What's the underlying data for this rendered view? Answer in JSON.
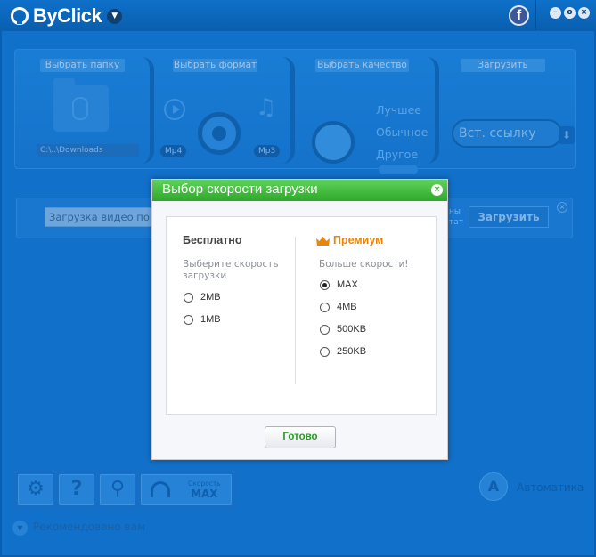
{
  "app": {
    "title": "ByClick"
  },
  "steps": {
    "folder_label": "Выбрать папку",
    "format_label": "Выбрать формат",
    "quality_label": "Выбрать качество",
    "download_label": "Загрузить",
    "folder_path": "C:\\..\\Downloads",
    "format_video": "Mp4",
    "format_audio": "Mp3",
    "quality_options": [
      "Лучшее",
      "Обычное",
      "Другое"
    ],
    "paste_link_label": "Вст. ссылку"
  },
  "urlbar": {
    "input_value": "Загрузка видео по на",
    "hint_line1": "ны",
    "hint_line2": "тат",
    "download_button": "Загрузить"
  },
  "toolbar": {
    "speed_label": "Скорость",
    "speed_value": "MAX",
    "auto_label": "Автоматика",
    "recommended_label": "Рекомендовано вам"
  },
  "dialog": {
    "title": "Выбор скорости загрузки",
    "free": {
      "title": "Бесплатно",
      "description": "Выберите скорость загрузки",
      "options": [
        "2MB",
        "1MB"
      ]
    },
    "premium": {
      "title": "Премиум",
      "description": "Больше скорости!",
      "options": [
        "MAX",
        "4MB",
        "500KB",
        "250KB"
      ],
      "selected": "MAX"
    },
    "done_button": "Готово"
  },
  "colors": {
    "accent_blue": "#0f74d1",
    "dialog_header_green": "#2ea82a",
    "premium_orange": "#e8850a",
    "facebook_blue": "#3b5998"
  }
}
